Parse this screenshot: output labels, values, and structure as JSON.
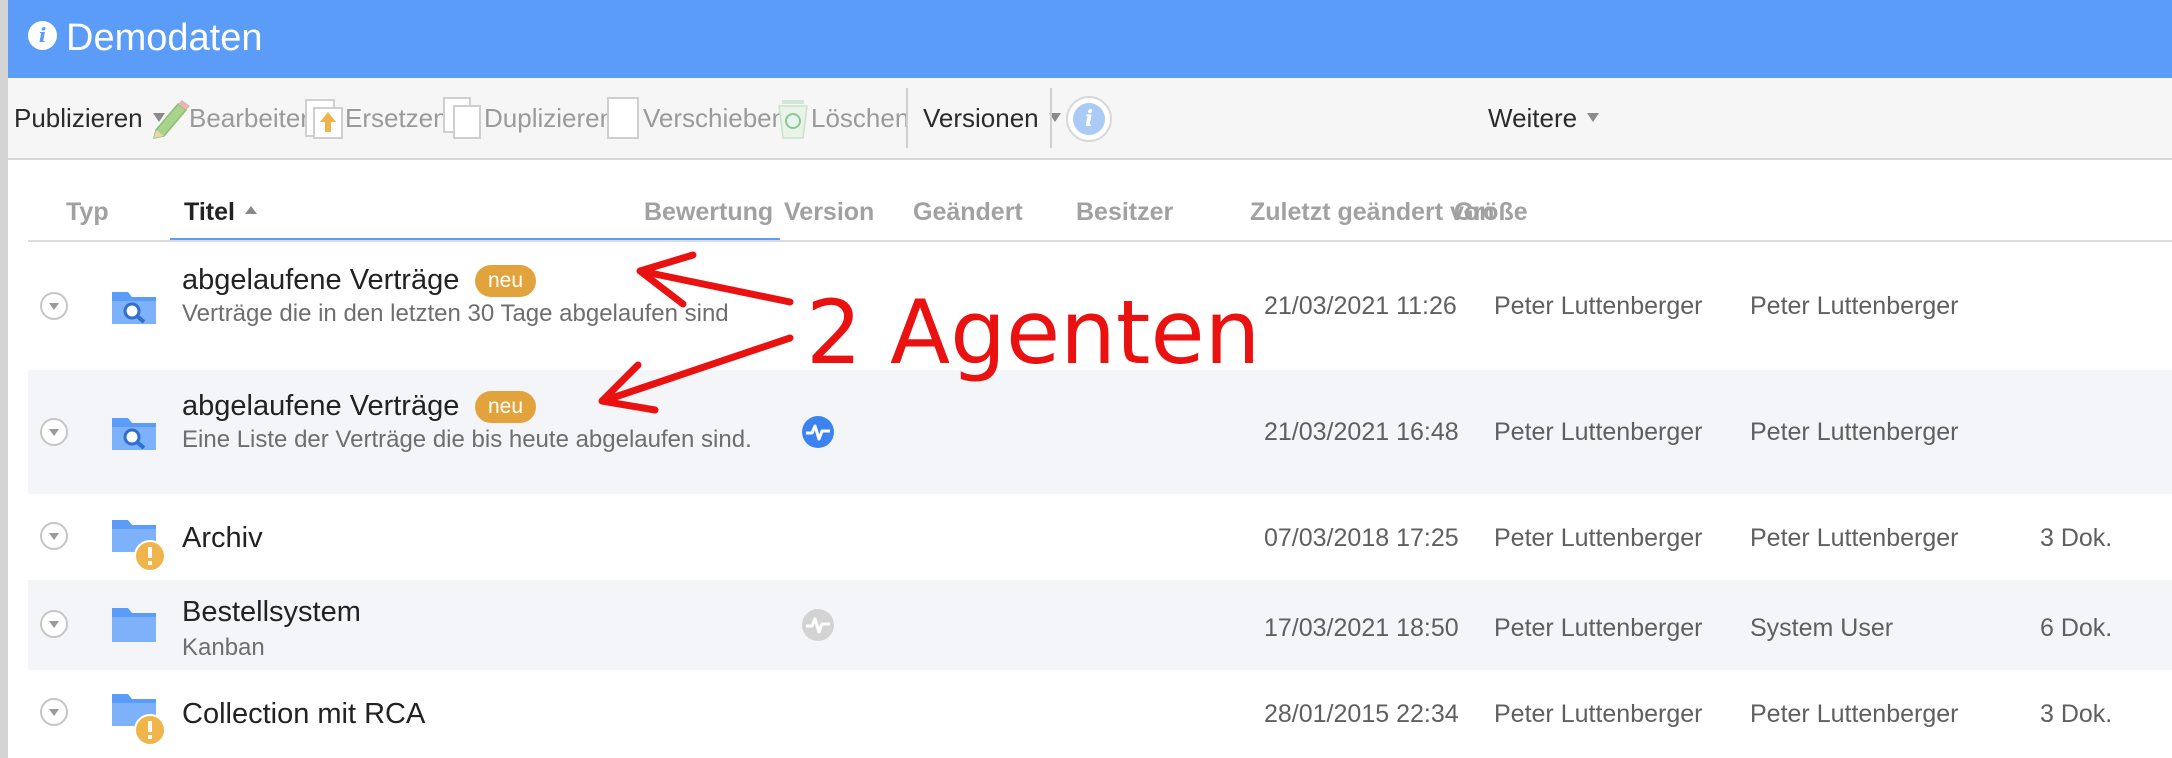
{
  "window": {
    "title": "Demodaten"
  },
  "toolbar": {
    "publish": "Publizieren",
    "edit": "Bearbeiten",
    "replace": "Ersetzen",
    "duplicate": "Duplizieren",
    "move": "Verschieben",
    "delete": "Löschen",
    "versions": "Versionen",
    "more": "Weitere"
  },
  "columns": {
    "type": "Typ",
    "title": "Titel",
    "rating": "Bewertung",
    "version": "Version",
    "changed": "Geändert",
    "owner": "Besitzer",
    "last_changed_by": "Zuletzt geändert von",
    "size": "Größe"
  },
  "rows": [
    {
      "title": "abgelaufene Verträge",
      "badge": "neu",
      "description": "Verträge die in den letzten 30 Tage abgelaufen sind",
      "icon": "search-folder-icon",
      "rating_icon": "",
      "changed": "21/03/2021 11:26",
      "owner": "Peter Luttenberger",
      "last_changed_by": "Peter Luttenberger",
      "size": ""
    },
    {
      "title": "abgelaufene Verträge",
      "badge": "neu",
      "description": "Eine Liste der Verträge die bis heute abgelaufen sind.",
      "icon": "search-folder-icon",
      "rating_icon": "activity-icon-active",
      "changed": "21/03/2021 16:48",
      "owner": "Peter Luttenberger",
      "last_changed_by": "Peter Luttenberger",
      "size": ""
    },
    {
      "title": "Archiv",
      "badge": "",
      "description": "",
      "icon": "folder-warning-icon",
      "rating_icon": "",
      "changed": "07/03/2018 17:25",
      "owner": "Peter Luttenberger",
      "last_changed_by": "Peter Luttenberger",
      "size": "3 Dok."
    },
    {
      "title": "Bestellsystem",
      "badge": "",
      "description": "Kanban",
      "icon": "folder-icon",
      "rating_icon": "activity-icon-inactive",
      "changed": "17/03/2021 18:50",
      "owner": "Peter Luttenberger",
      "last_changed_by": "System User",
      "size": "6 Dok."
    },
    {
      "title": "Collection mit RCA",
      "badge": "",
      "description": "",
      "icon": "folder-warning-icon",
      "rating_icon": "",
      "changed": "28/01/2015 22:34",
      "owner": "Peter Luttenberger",
      "last_changed_by": "Peter Luttenberger",
      "size": "3 Dok."
    }
  ],
  "annotation": {
    "text": "2 Agenten",
    "color": "#ea1111"
  },
  "colors": {
    "titlebar": "#5b9cf8",
    "badge": "#e3a33c",
    "accent": "#5b9cf8"
  }
}
